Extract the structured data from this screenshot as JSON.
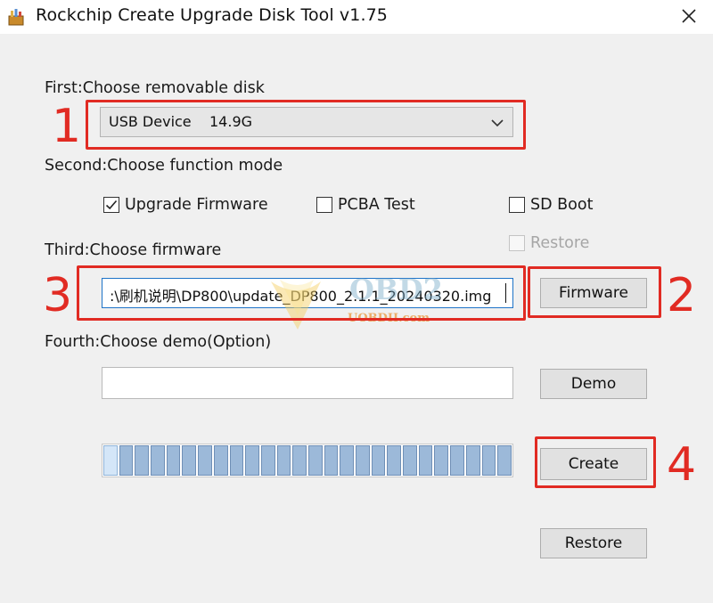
{
  "window": {
    "title": "Rockchip Create Upgrade Disk Tool v1.75",
    "icon": "app-icon",
    "close_icon": "close-icon"
  },
  "steps": {
    "first_label": "First:Choose removable disk",
    "second_label": "Second:Choose function mode",
    "third_label": "Third:Choose firmware",
    "fourth_label": "Fourth:Choose demo(Option)"
  },
  "disk_select": {
    "value": "USB Device    14.9G"
  },
  "modes": {
    "upgrade_firmware": {
      "label": "Upgrade Firmware",
      "checked": true
    },
    "pcba_test": {
      "label": "PCBA Test",
      "checked": false
    },
    "sd_boot": {
      "label": "SD Boot",
      "checked": false
    },
    "restore": {
      "label": "Restore",
      "checked": false,
      "disabled": true
    }
  },
  "firmware_path": {
    "value": ":\\刷机说明\\DP800\\update_DP800_2.1.1_20240320.img"
  },
  "demo_path": {
    "value": ""
  },
  "buttons": {
    "firmware": "Firmware",
    "demo": "Demo",
    "create": "Create",
    "restore": "Restore"
  },
  "progress": {
    "segments_total": 26,
    "segments_filled": 26
  },
  "annotations": {
    "marker_1": "1",
    "marker_2": "2",
    "marker_3": "3",
    "marker_4": "4",
    "color": "#e12b23"
  },
  "watermark": {
    "brand": "OBD2",
    "site": "UOBDII.com"
  }
}
